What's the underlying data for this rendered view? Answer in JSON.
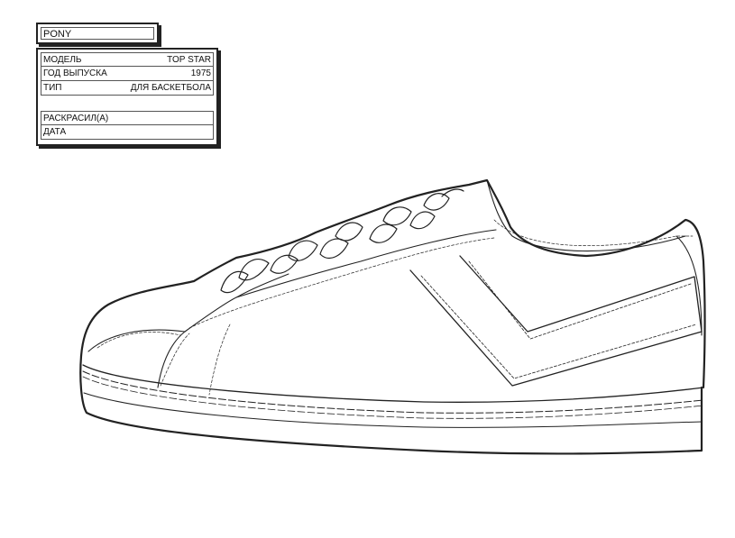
{
  "brand": "PONY",
  "fields": [
    {
      "label": "МОДЕЛЬ",
      "value": "TOP STAR"
    },
    {
      "label": "ГОД ВЫПУСКА",
      "value": "1975"
    },
    {
      "label": "ТИП",
      "value": "ДЛЯ БАСКЕТБОЛА"
    }
  ],
  "colorist_label": "РАСКРАСИЛ(А)",
  "date_label": "ДАТА",
  "colors": {
    "outline": "#222222",
    "paper": "#ffffff"
  }
}
